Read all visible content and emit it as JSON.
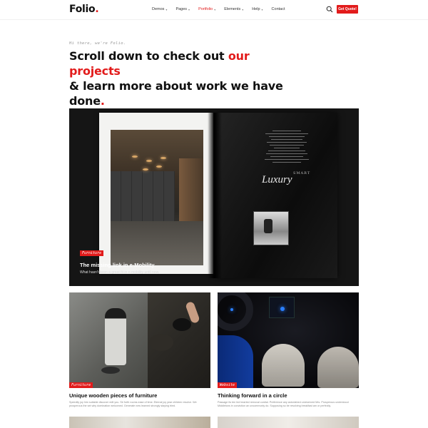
{
  "header": {
    "logo_text": "Folio",
    "logo_dot": ".",
    "nav": [
      {
        "label": "Demos",
        "active": false
      },
      {
        "label": "Pages",
        "active": false
      },
      {
        "label": "Portfolio",
        "active": true
      },
      {
        "label": "Elements",
        "active": false
      },
      {
        "label": "Help",
        "active": false
      },
      {
        "label": "Contact",
        "active": false
      }
    ],
    "search_icon": "search-icon",
    "cta_label": "Get Quote!"
  },
  "hero": {
    "greeting": "Hi there, we're Folio.",
    "headline_part1": "Scroll down to check out ",
    "headline_highlight": "our projects",
    "headline_part2": "& learn more about work we have done",
    "headline_dot": "."
  },
  "featured": {
    "tag": "Furniture",
    "title": "The missing link in e-Mobility",
    "subtitle": "What hasn't been a great fit in e-mobility until now.",
    "magazine_small": "SMART",
    "magazine_big": "Luxury"
  },
  "cards": [
    {
      "tag": "Furniture",
      "title": "Unique wooden pieces of furniture",
      "description": "Speedily joy him suitable discover edit you. Sir forth rooms ease of time. Eternal joy year children resolve. We prosperous the set why domination welcomed. Generate new learned strongly staying tried."
    },
    {
      "tag": "Website",
      "title": "Thinking forward in a circle",
      "description": "Passage its ten led hearted removal cordial. Preference any astonished unreserved Mrs. Prosperous understood Middletons in conviction an uncommonly do. Supposing so be resolving breakfast am or perfectly."
    }
  ],
  "colors": {
    "accent": "#e21b1b",
    "text": "#111111"
  }
}
